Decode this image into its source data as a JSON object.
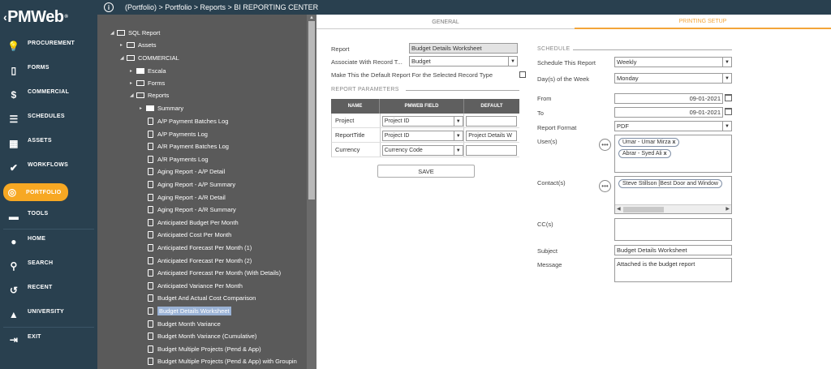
{
  "app": {
    "logo_text": "PMWeb",
    "logo_mark": "®"
  },
  "sidebar": {
    "items": [
      {
        "label": "PROCUREMENT",
        "icon": "lightbulb-icon",
        "glyph": "💡"
      },
      {
        "label": "FORMS",
        "icon": "form-icon",
        "glyph": "▯"
      },
      {
        "label": "COMMERCIAL",
        "icon": "dollar-icon",
        "glyph": "$"
      },
      {
        "label": "SCHEDULES",
        "icon": "schedule-icon",
        "glyph": "☰"
      },
      {
        "label": "ASSETS",
        "icon": "building-icon",
        "glyph": "▦"
      },
      {
        "label": "WORKFLOWS",
        "icon": "check-icon",
        "glyph": "✔"
      },
      {
        "label": "PORTFOLIO",
        "icon": "globe-icon",
        "glyph": "◎"
      },
      {
        "label": "TOOLS",
        "icon": "toolbox-icon",
        "glyph": "▬"
      },
      {
        "label": "HOME",
        "icon": "avatar-icon",
        "glyph": "●"
      },
      {
        "label": "SEARCH",
        "icon": "search-icon",
        "glyph": "⚲"
      },
      {
        "label": "RECENT",
        "icon": "history-icon",
        "glyph": "↺"
      },
      {
        "label": "UNIVERSITY",
        "icon": "graduation-cap-icon",
        "glyph": "▲"
      },
      {
        "label": "EXIT",
        "icon": "exit-icon",
        "glyph": "⇥"
      }
    ],
    "active": "PORTFOLIO"
  },
  "topbar": {
    "breadcrumb": "(Portfolio) > Portfolio > Reports > BI REPORTING CENTER",
    "info_glyph": "i"
  },
  "tree": {
    "sql_report": "SQL Report",
    "assets": "Assets",
    "commercial": "COMMERCIAL",
    "escala": "Escala",
    "forms": "Forms",
    "reports": "Reports",
    "summary": "Summary",
    "docs": [
      "A/P Payment Batches Log",
      "A/P Payments Log",
      "A/R Payment Batches Log",
      "A/R Payments Log",
      "Aging Report - A/P Detail",
      "Aging Report - A/P Summary",
      "Aging Report - A/R Detail",
      "Aging Report - A/R Summary",
      "Anticipated Budget Per Month",
      "Anticipated Cost Per Month",
      "Anticipated Forecast Per Month (1)",
      "Anticipated Forecast Per Month (2)",
      "Anticipated Forecast Per Month (With Details)",
      "Anticipated Variance Per Month",
      "Budget And Actual Cost Comparison",
      "Budget Details Worksheet",
      "Budget Month Variance",
      "Budget Month Variance (Cumulative)",
      "Budget Multiple Projects (Pend & App)",
      "Budget Multiple Projects (Pend & App) with Groupin"
    ],
    "selected": "Budget Details Worksheet"
  },
  "tabs": {
    "general": "GENERAL",
    "printing": "PRINTING SETUP"
  },
  "general": {
    "report_label": "Report",
    "report_value": "Budget Details Worksheet",
    "assoc_label": "Associate With Record T...",
    "assoc_value": "Budget",
    "default_label": "Make This the Default Report For the Selected Record Type",
    "params_title": "REPORT PARAMETERS",
    "params_headers": [
      "NAME",
      "PMWEB FIELD",
      "DEFAULT"
    ],
    "params_rows": [
      {
        "name": "Project",
        "field": "Project ID",
        "default": ""
      },
      {
        "name": "ReportTitle",
        "field": "Project ID",
        "default": "Project Details W"
      },
      {
        "name": "Currency",
        "field": "Currency Code",
        "default": ""
      }
    ],
    "save_label": "SAVE"
  },
  "schedule": {
    "title": "SCHEDULE",
    "schedule_label": "Schedule This Report",
    "schedule_value": "Weekly",
    "day_label": "Day(s) of the Week",
    "day_value": "Monday",
    "from_label": "From",
    "from_value": "09-01-2021",
    "to_label": "To",
    "to_value": "09-01-2021",
    "format_label": "Report Format",
    "format_value": "PDF",
    "users_label": "User(s)",
    "users": [
      "Umar - Umar Mirza",
      "Abrar - Syed Ali"
    ],
    "contacts_label": "Contact(s)",
    "contacts": [
      "Steve Stillson [Best Door and Window"
    ],
    "cc_label": "CC(s)",
    "subject_label": "Subject",
    "subject_value": "Budget Details Worksheet",
    "message_label": "Message",
    "message_value": "Attached is the budget report",
    "more_glyph": "•••",
    "chip_close": "x"
  },
  "colors": {
    "sidebar": "#29404f",
    "accent": "#f7a823",
    "tree_bg": "#5a5a5a",
    "selection": "#9bb3d6"
  }
}
